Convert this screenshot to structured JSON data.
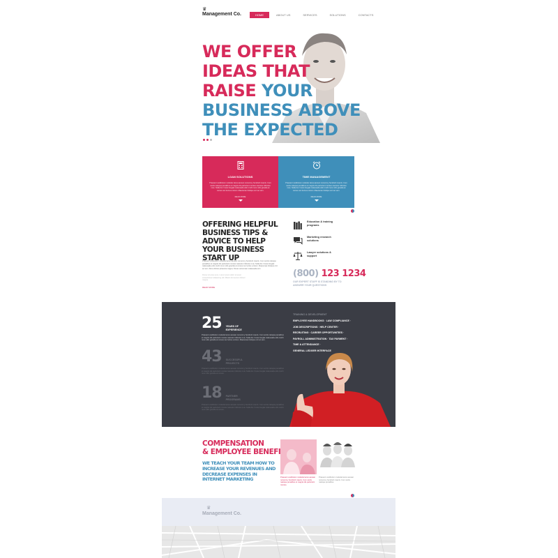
{
  "brand": {
    "name": "Management Co.",
    "crown_icon": "crown-icon"
  },
  "nav": {
    "items": [
      "HOME",
      "ABOUT US",
      "SERVICES",
      "SOLUTIONS",
      "CONTACTS"
    ],
    "active": "HOME"
  },
  "hero": {
    "line1": "WE OFFER",
    "line2": "IDEAS THAT",
    "line3_a": "RAISE",
    "line3_b": "YOUR",
    "line4": "BUSINESS ABOVE",
    "line5": "THE EXPECTED"
  },
  "cards": [
    {
      "title": "LOAN SOLUTIONS",
      "desc": "Praesent vestibulum molestie lacus aenean nonummy hendrerit mauris. Cum sociis natoque penatibus et magnis dis parturient montes nascetur ridiculus mus. Nulla dui. Fusce feugiat malesuada odio morbi nunc odio gravida at cursus nec luctus a lorem. Maecenas tristique orci ac sem.",
      "more": "READ MORE",
      "icon": "calculator-icon",
      "color": "#d72a5a"
    },
    {
      "title": "TIME MANAGEMENT",
      "desc": "Praesent vestibulum molestie lacus aenean nonummy hendrerit mauris. Cum sociis natoque penatibus et magnis dis parturient montes nascetur ridiculus mus. Nulla dui. Fusce feugiat malesuada odio morbi nunc odio gravida at cursus nec luctus a lorem. Maecenas tristique orci ac sem.",
      "more": "READ MORE",
      "icon": "alarm-clock-icon",
      "color": "#3f8fba"
    }
  ],
  "tips": {
    "heading": "OFFERING HELPFUL BUSINESS TIPS & ADVICE TO HELP YOUR BUSINESS START UP",
    "para1": "Praesent vestibulum molestie lacus aenean nonummy hendrerit mauris. Cum sociis natoque penatibus et magnis dis parturient montes nascetur ridiculus mus. Nulla dui. Fusce feugiat malesuada odio morbi nunc odio gravida at cursus nec luctus a lorem. Maecenas tristique orci ac sem. Duis ultricies pharetra magna. Donec accumsan malesuada orci.",
    "para2": "Donec sit amet eros. Lorem ipsum dolor sit amet consectetuer adipiscing elit. Mauris fermentum dictum magna.",
    "more": "READ MORE"
  },
  "features": [
    {
      "label": "Education & training programs",
      "icon": "books-icon"
    },
    {
      "label": "Marketing research solutions",
      "icon": "chat-bubble-icon"
    },
    {
      "label": "Lawyer solutions & support",
      "icon": "scales-icon"
    }
  ],
  "phone": {
    "prefix": "(800)",
    "number": "123 1234",
    "sub": "OUR EXPERT STAFF IS STANDING BY TO ANSWER YOUR QUESTIONS"
  },
  "stats": [
    {
      "num": "25",
      "label": "YEARS OF EXPERIENCE",
      "para": "Praesent vestibulum molestie lacus aenean nonummy hendrerit mauris. Cum sociis natoque penatibus et magnis dis parturient montes nascetur ridiculus mus. Nulla dui. Fusce feugiat malesuada odio morbi nunc odio gravida at cursus nec luctus a lorem. Maecenas tristique orci ac sem."
    },
    {
      "num": "43",
      "label": "SUCCESSFUL PROJECTS",
      "para": "Praesent vestibulum molestie lacus aenean nonummy hendrerit mauris. Cum sociis natoque penatibus et magnis dis parturient montes nascetur ridiculus mus. Nulla dui. Fusce feugiat malesuada odio morbi nunc odio gravida at cursus."
    },
    {
      "num": "18",
      "label": "PARTNER PROGRAMS",
      "para": "Praesent vestibulum molestie lacus aenean nonummy hendrerit mauris. Cum sociis natoque penatibus et magnis dis parturient montes nascetur ridiculus mus. Nulla dui. Fusce feugiat malesuada odio morbi nunc odio gravida at cursus."
    }
  ],
  "training": {
    "label": "TRAINING & DEVELOPMENT",
    "lines": [
      "EMPLOYEE HANDBOOKS · LAW COMPLIANCE ·",
      "JOB DESCRIPTIONS · HELP CENTER ·",
      "RECRUITING · CAREER OPPORTUNITIES ·",
      "PAYROLL ADMINISTRATION · TAX PAYMENT ·",
      "TIME & ATTENDANCE ·",
      "GENERAL LEDGER INTERFACE"
    ]
  },
  "comp": {
    "heading1": "COMPENSATION",
    "heading2": "& EMPLOYEE BENEFITS:",
    "sub": "WE TEACH YOUR TEAM HOW TO INCREASE YOUR REVENUES AND DECREASE EXPENSES IN INTERNET MARKETING",
    "cap1": "Praesent vestibulum molestie lacus aenean nonummy hendrerit mauris. Cum sociis natoque penatibus et magnis dis parturient montes.",
    "cap2": "Praesent vestibulum molestie lacus aenean nonummy hendrerit mauris. Cum sociis natoque penatibus."
  },
  "colors": {
    "pink": "#d72a5a",
    "blue": "#3f8fba",
    "dark": "#3b3d45"
  }
}
